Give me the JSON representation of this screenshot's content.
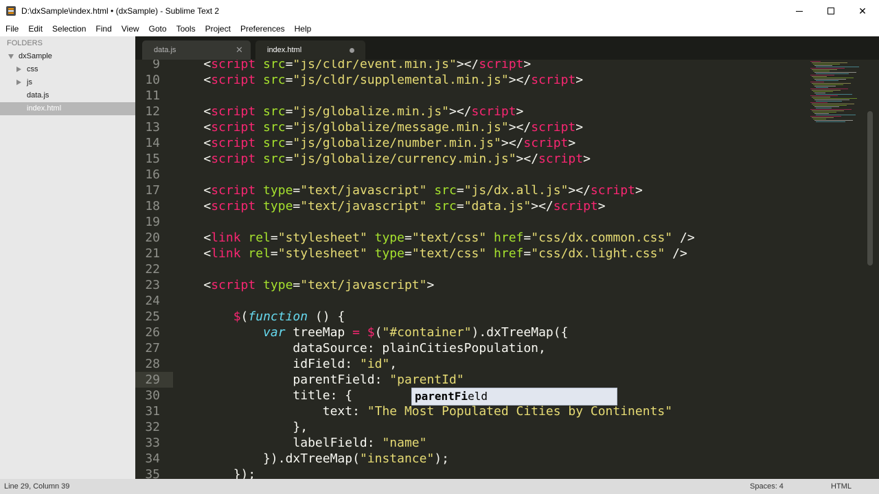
{
  "window": {
    "title": "D:\\dxSample\\index.html • (dxSample) - Sublime Text 2",
    "min_glyph": "",
    "max_glyph": "",
    "close_glyph": "✕"
  },
  "menu": [
    "File",
    "Edit",
    "Selection",
    "Find",
    "View",
    "Goto",
    "Tools",
    "Project",
    "Preferences",
    "Help"
  ],
  "sidebar": {
    "heading": "FOLDERS",
    "items": [
      {
        "label": "dxSample",
        "indent": 1,
        "arrow": "down"
      },
      {
        "label": "css",
        "indent": 2,
        "arrow": "right"
      },
      {
        "label": "js",
        "indent": 2,
        "arrow": "right"
      },
      {
        "label": "data.js",
        "indent": 2,
        "arrow": ""
      },
      {
        "label": "index.html",
        "indent": 2,
        "arrow": "",
        "selected": true
      }
    ]
  },
  "tabs": [
    {
      "label": "data.js",
      "close": "✕",
      "active": false
    },
    {
      "label": "index.html",
      "active": true,
      "modified": true
    }
  ],
  "editor": {
    "lines": [
      {
        "n": 9,
        "tokens": [
          [
            "txt",
            "    <"
          ],
          [
            "tg",
            "script"
          ],
          [
            "at",
            " src"
          ],
          [
            "txt",
            "="
          ],
          [
            "st",
            "\"js/cldr/event.min.js\""
          ],
          [
            "txt",
            "></"
          ],
          [
            "tg",
            "script"
          ],
          [
            "txt",
            ">"
          ]
        ]
      },
      {
        "n": 10,
        "tokens": [
          [
            "txt",
            "    <"
          ],
          [
            "tg",
            "script"
          ],
          [
            "at",
            " src"
          ],
          [
            "txt",
            "="
          ],
          [
            "st",
            "\"js/cldr/supplemental.min.js\""
          ],
          [
            "txt",
            "></"
          ],
          [
            "tg",
            "script"
          ],
          [
            "txt",
            ">"
          ]
        ]
      },
      {
        "n": 11,
        "tokens": []
      },
      {
        "n": 12,
        "tokens": [
          [
            "txt",
            "    <"
          ],
          [
            "tg",
            "script"
          ],
          [
            "at",
            " src"
          ],
          [
            "txt",
            "="
          ],
          [
            "st",
            "\"js/globalize.min.js\""
          ],
          [
            "txt",
            "></"
          ],
          [
            "tg",
            "script"
          ],
          [
            "txt",
            ">"
          ]
        ]
      },
      {
        "n": 13,
        "tokens": [
          [
            "txt",
            "    <"
          ],
          [
            "tg",
            "script"
          ],
          [
            "at",
            " src"
          ],
          [
            "txt",
            "="
          ],
          [
            "st",
            "\"js/globalize/message.min.js\""
          ],
          [
            "txt",
            "></"
          ],
          [
            "tg",
            "script"
          ],
          [
            "txt",
            ">"
          ]
        ]
      },
      {
        "n": 14,
        "tokens": [
          [
            "txt",
            "    <"
          ],
          [
            "tg",
            "script"
          ],
          [
            "at",
            " src"
          ],
          [
            "txt",
            "="
          ],
          [
            "st",
            "\"js/globalize/number.min.js\""
          ],
          [
            "txt",
            "></"
          ],
          [
            "tg",
            "script"
          ],
          [
            "txt",
            ">"
          ]
        ]
      },
      {
        "n": 15,
        "tokens": [
          [
            "txt",
            "    <"
          ],
          [
            "tg",
            "script"
          ],
          [
            "at",
            " src"
          ],
          [
            "txt",
            "="
          ],
          [
            "st",
            "\"js/globalize/currency.min.js\""
          ],
          [
            "txt",
            "></"
          ],
          [
            "tg",
            "script"
          ],
          [
            "txt",
            ">"
          ]
        ]
      },
      {
        "n": 16,
        "tokens": []
      },
      {
        "n": 17,
        "tokens": [
          [
            "txt",
            "    <"
          ],
          [
            "tg",
            "script"
          ],
          [
            "at",
            " type"
          ],
          [
            "txt",
            "="
          ],
          [
            "st",
            "\"text/javascript\""
          ],
          [
            "at",
            " src"
          ],
          [
            "txt",
            "="
          ],
          [
            "st",
            "\"js/dx.all.js\""
          ],
          [
            "txt",
            "></"
          ],
          [
            "tg",
            "script"
          ],
          [
            "txt",
            ">"
          ]
        ]
      },
      {
        "n": 18,
        "tokens": [
          [
            "txt",
            "    <"
          ],
          [
            "tg",
            "script"
          ],
          [
            "at",
            " type"
          ],
          [
            "txt",
            "="
          ],
          [
            "st",
            "\"text/javascript\""
          ],
          [
            "at",
            " src"
          ],
          [
            "txt",
            "="
          ],
          [
            "st",
            "\"data.js\""
          ],
          [
            "txt",
            "></"
          ],
          [
            "tg",
            "script"
          ],
          [
            "txt",
            ">"
          ]
        ]
      },
      {
        "n": 19,
        "tokens": []
      },
      {
        "n": 20,
        "tokens": [
          [
            "txt",
            "    <"
          ],
          [
            "tg",
            "link"
          ],
          [
            "at",
            " rel"
          ],
          [
            "txt",
            "="
          ],
          [
            "st",
            "\"stylesheet\""
          ],
          [
            "at",
            " type"
          ],
          [
            "txt",
            "="
          ],
          [
            "st",
            "\"text/css\""
          ],
          [
            "at",
            " href"
          ],
          [
            "txt",
            "="
          ],
          [
            "st",
            "\"css/dx.common.css\""
          ],
          [
            "txt",
            " />"
          ]
        ]
      },
      {
        "n": 21,
        "tokens": [
          [
            "txt",
            "    <"
          ],
          [
            "tg",
            "link"
          ],
          [
            "at",
            " rel"
          ],
          [
            "txt",
            "="
          ],
          [
            "st",
            "\"stylesheet\""
          ],
          [
            "at",
            " type"
          ],
          [
            "txt",
            "="
          ],
          [
            "st",
            "\"text/css\""
          ],
          [
            "at",
            " href"
          ],
          [
            "txt",
            "="
          ],
          [
            "st",
            "\"css/dx.light.css\""
          ],
          [
            "txt",
            " />"
          ]
        ]
      },
      {
        "n": 22,
        "tokens": []
      },
      {
        "n": 23,
        "tokens": [
          [
            "txt",
            "    <"
          ],
          [
            "tg",
            "script"
          ],
          [
            "at",
            " type"
          ],
          [
            "txt",
            "="
          ],
          [
            "st",
            "\"text/javascript\""
          ],
          [
            "txt",
            ">"
          ]
        ]
      },
      {
        "n": 24,
        "tokens": []
      },
      {
        "n": 25,
        "tokens": [
          [
            "txt",
            "        "
          ],
          [
            "tg",
            "$"
          ],
          [
            "txt",
            "("
          ],
          [
            "kw",
            "function"
          ],
          [
            "txt",
            " () {"
          ]
        ]
      },
      {
        "n": 26,
        "tokens": [
          [
            "txt",
            "            "
          ],
          [
            "kw",
            "var"
          ],
          [
            "txt",
            " treeMap "
          ],
          [
            "tg",
            "="
          ],
          [
            "txt",
            " "
          ],
          [
            "tg",
            "$"
          ],
          [
            "txt",
            "("
          ],
          [
            "st",
            "\"#container\""
          ],
          [
            "txt",
            ").dxTreeMap({"
          ]
        ]
      },
      {
        "n": 27,
        "tokens": [
          [
            "txt",
            "                dataSource: plainCitiesPopulation,"
          ]
        ]
      },
      {
        "n": 28,
        "tokens": [
          [
            "txt",
            "                idField: "
          ],
          [
            "st",
            "\"id\""
          ],
          [
            "txt",
            ","
          ]
        ]
      },
      {
        "n": 29,
        "tokens": [
          [
            "txt",
            "                parentField: "
          ],
          [
            "st",
            "\"parentId\""
          ]
        ]
      },
      {
        "n": 30,
        "tokens": [
          [
            "txt",
            "                title: {"
          ]
        ]
      },
      {
        "n": 31,
        "tokens": [
          [
            "txt",
            "                    text: "
          ],
          [
            "st",
            "\"The Most Populated Cities by Continents\""
          ]
        ]
      },
      {
        "n": 32,
        "tokens": [
          [
            "txt",
            "                },"
          ]
        ]
      },
      {
        "n": 33,
        "tokens": [
          [
            "txt",
            "                labelField: "
          ],
          [
            "st",
            "\"name\""
          ]
        ]
      },
      {
        "n": 34,
        "tokens": [
          [
            "txt",
            "            })."
          ],
          [
            "txt",
            "dxTreeMap("
          ],
          [
            "st",
            "\"instance\""
          ],
          [
            "txt",
            ");"
          ]
        ]
      },
      {
        "n": 35,
        "tokens": [
          [
            "txt",
            "        });"
          ]
        ]
      }
    ],
    "active_line": 29
  },
  "autocomplete": {
    "match": "parentFi",
    "rest": "eld"
  },
  "colors": {
    "tag": "#f92672",
    "attr": "#a6e22e",
    "string": "#e6db74",
    "keyword": "#66d9ef",
    "text": "#f8f8f2",
    "background": "#272822"
  },
  "status": {
    "position": "Line 29, Column 39",
    "spaces": "Spaces: 4",
    "syntax": "HTML"
  }
}
